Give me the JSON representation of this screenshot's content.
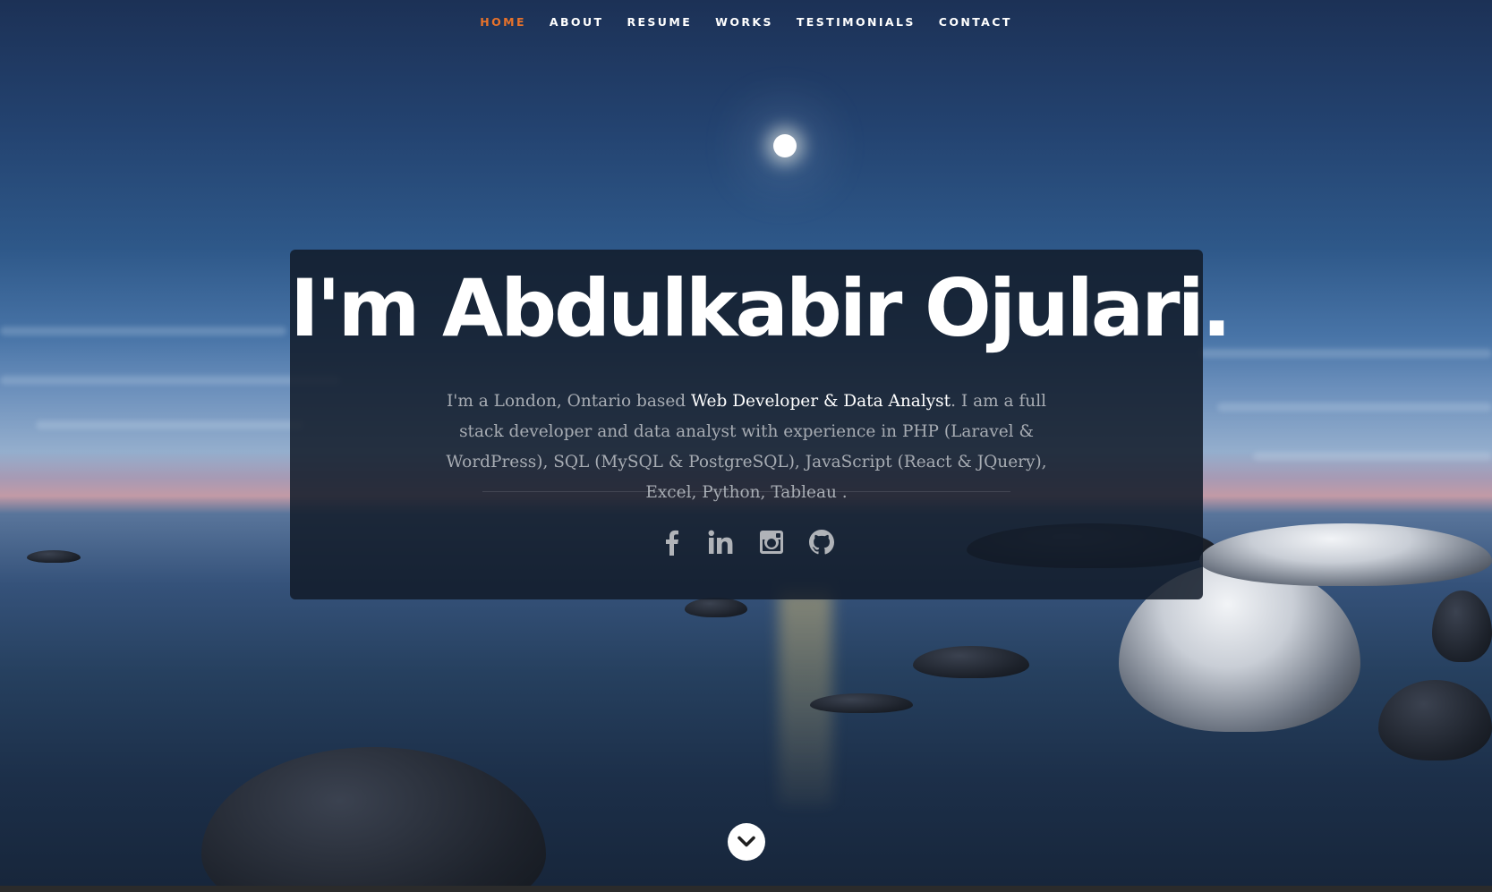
{
  "nav": {
    "items": [
      {
        "label": "HOME",
        "active": true
      },
      {
        "label": "ABOUT",
        "active": false
      },
      {
        "label": "RESUME",
        "active": false
      },
      {
        "label": "WORKS",
        "active": false
      },
      {
        "label": "TESTIMONIALS",
        "active": false
      },
      {
        "label": "CONTACT",
        "active": false
      }
    ],
    "active_color": "#e8722a",
    "text_color": "#ffffff"
  },
  "banner": {
    "headline": "I'm Abdulkabir Ojulari.",
    "intro_before": "I'm a London, Ontario based ",
    "intro_highlight": "Web Developer & Data Analyst",
    "intro_after": ". I am a full stack developer and data analyst with experience in PHP (Laravel & WordPress), SQL (MySQL & PostgreSQL), JavaScript (React & JQuery), Excel, Python, Tableau ."
  },
  "social": [
    {
      "icon": "facebook-icon"
    },
    {
      "icon": "linkedin-icon"
    },
    {
      "icon": "instagram-icon"
    },
    {
      "icon": "github-icon"
    }
  ],
  "scroll_down": {
    "icon": "chevron-down-icon"
  }
}
